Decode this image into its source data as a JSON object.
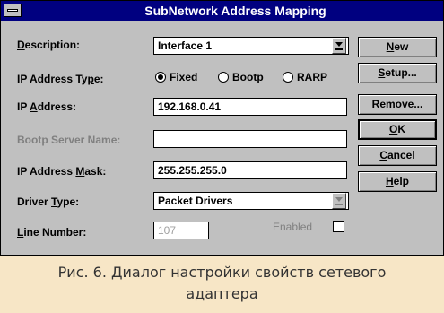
{
  "window": {
    "title": "SubNetwork Address Mapping"
  },
  "fields": {
    "description": {
      "label_pre": "",
      "label_ul": "D",
      "label_post": "escription:",
      "value": "Interface 1"
    },
    "ip_type": {
      "label_pre": "IP Address Ty",
      "label_ul": "p",
      "label_post": "e:"
    },
    "ip_address": {
      "label_pre": "IP ",
      "label_ul": "A",
      "label_post": "ddress:",
      "value": "192.168.0.41"
    },
    "bootp_server": {
      "label": "Bootp Server Name:",
      "value": ""
    },
    "ip_mask": {
      "label_pre": "IP Address ",
      "label_ul": "M",
      "label_post": "ask:",
      "value": "255.255.255.0"
    },
    "driver_type": {
      "label_pre": "Driver ",
      "label_ul": "T",
      "label_post": "ype:",
      "value": "Packet Drivers"
    },
    "line_number": {
      "label_pre": "",
      "label_ul": "L",
      "label_post": "ine Number:",
      "value": "107"
    },
    "enabled": {
      "label": "Enabled",
      "checked": false
    }
  },
  "radios": [
    {
      "label": "Fixed",
      "selected": true
    },
    {
      "label": "Bootp",
      "selected": false
    },
    {
      "label": "RARP",
      "selected": false
    }
  ],
  "buttons": {
    "new": {
      "pre": "",
      "ul": "N",
      "post": "ew"
    },
    "setup": {
      "pre": "",
      "ul": "S",
      "post": "etup..."
    },
    "remove": {
      "pre": "",
      "ul": "R",
      "post": "emove..."
    },
    "ok": {
      "pre": "",
      "ul": "O",
      "post": "K"
    },
    "cancel": {
      "pre": "",
      "ul": "C",
      "post": "ancel"
    },
    "help": {
      "pre": "",
      "ul": "H",
      "post": "elp"
    }
  },
  "caption": "Рис. 6. Диалог настройки свойств сетевого адаптера"
}
